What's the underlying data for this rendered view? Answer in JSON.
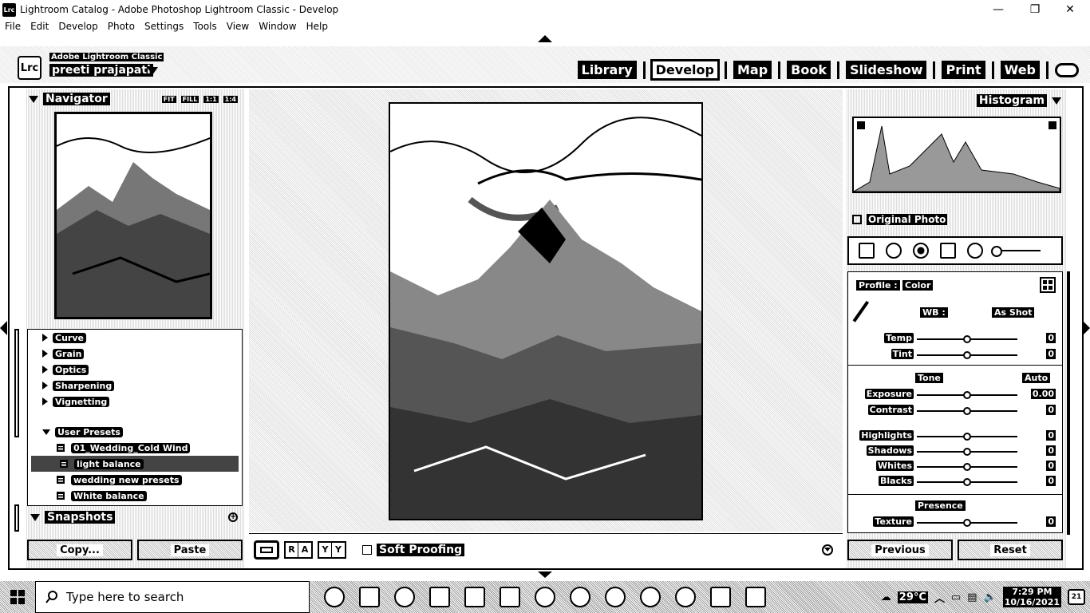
{
  "window": {
    "app_badge": "Lrc",
    "title": "Lightroom Catalog - Adobe Photoshop Lightroom Classic - Develop",
    "controls": [
      "—",
      "❐",
      "✕"
    ]
  },
  "menu": [
    "File",
    "Edit",
    "Develop",
    "Photo",
    "Settings",
    "Tools",
    "View",
    "Window",
    "Help"
  ],
  "identity": {
    "logo": "Lrc",
    "product": "Adobe Lightroom Classic",
    "user": "preeti prajapati"
  },
  "modules": [
    "Library",
    "Develop",
    "Map",
    "Book",
    "Slideshow",
    "Print",
    "Web"
  ],
  "active_module": "Develop",
  "navigator": {
    "title": "Navigator",
    "zoom": [
      "FIT",
      "FILL",
      "1:1",
      "1:4"
    ]
  },
  "presets": {
    "groups": [
      "Curve",
      "Grain",
      "Optics",
      "Sharpening",
      "Vignetting"
    ],
    "user_group": "User Presets",
    "user_items": [
      "01_Wedding_Cold Wind",
      "light balance",
      "wedding new presets",
      "White balance"
    ],
    "selected_index": 1
  },
  "snapshots": {
    "title": "Snapshots",
    "add": "+"
  },
  "left_buttons": {
    "copy": "Copy...",
    "paste": "Paste"
  },
  "toolbar": {
    "ra": [
      "R",
      "A"
    ],
    "yy": [
      "Y",
      "Y"
    ],
    "soft_proofing": "Soft Proofing"
  },
  "histogram": {
    "title": "Histogram",
    "original_photo": "Original Photo"
  },
  "basic": {
    "profile_label": "Profile :",
    "profile_value": "Color",
    "wb_label": "WB :",
    "wb_value": "As Shot",
    "tone_label": "Tone",
    "auto_label": "Auto",
    "presence_label": "Presence",
    "wb_sliders": [
      {
        "label": "Temp",
        "value": "0",
        "pos": 0.5
      },
      {
        "label": "Tint",
        "value": "0",
        "pos": 0.5
      }
    ],
    "tone_sliders": [
      {
        "label": "Exposure",
        "value": "0.00",
        "pos": 0.5
      },
      {
        "label": "Contrast",
        "value": "0",
        "pos": 0.5
      }
    ],
    "tone_sliders2": [
      {
        "label": "Highlights",
        "value": "0",
        "pos": 0.5
      },
      {
        "label": "Shadows",
        "value": "0",
        "pos": 0.5
      },
      {
        "label": "Whites",
        "value": "0",
        "pos": 0.5
      },
      {
        "label": "Blacks",
        "value": "0",
        "pos": 0.5
      }
    ],
    "presence_sliders": [
      {
        "label": "Texture",
        "value": "0",
        "pos": 0.5
      }
    ]
  },
  "right_buttons": {
    "previous": "Previous",
    "reset": "Reset"
  },
  "taskbar": {
    "search_placeholder": "Type here to search",
    "temperature": "29°C",
    "time": "7:29 PM",
    "date": "10/16/2021",
    "notifications": "21"
  }
}
